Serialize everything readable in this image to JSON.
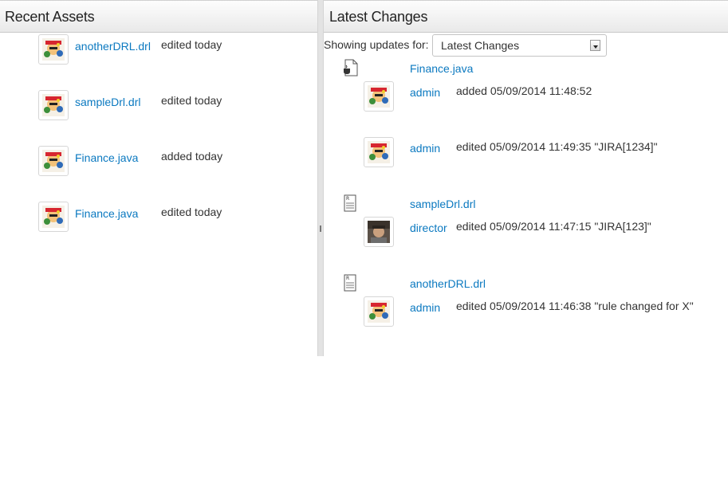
{
  "recent": {
    "title": "Recent Assets",
    "items": [
      {
        "name": "anotherDRL.drl",
        "status": "edited today"
      },
      {
        "name": "sampleDrl.drl",
        "status": "edited today"
      },
      {
        "name": "Finance.java",
        "status": "added today"
      },
      {
        "name": "Finance.java",
        "status": "edited today"
      }
    ]
  },
  "latest": {
    "title": "Latest Changes",
    "showing_label": "Showing updates for:",
    "selected": "Latest Changes",
    "groups": [
      {
        "file": "Finance.java",
        "icon": "java-file-icon",
        "changes": [
          {
            "user": "admin",
            "text": "added 05/09/2014 11:48:52"
          },
          {
            "user": "admin",
            "text": "edited 05/09/2014 11:49:35 \"JIRA[1234]\""
          }
        ]
      },
      {
        "file": "sampleDrl.drl",
        "icon": "rule-file-icon",
        "changes": [
          {
            "user": "director",
            "text": "edited 05/09/2014 11:47:15 \"JIRA[123]\""
          }
        ]
      },
      {
        "file": "anotherDRL.drl",
        "icon": "rule-file-icon",
        "changes": [
          {
            "user": "admin",
            "text": "edited 05/09/2014 11:46:38 \"rule changed for X\""
          }
        ]
      }
    ]
  }
}
